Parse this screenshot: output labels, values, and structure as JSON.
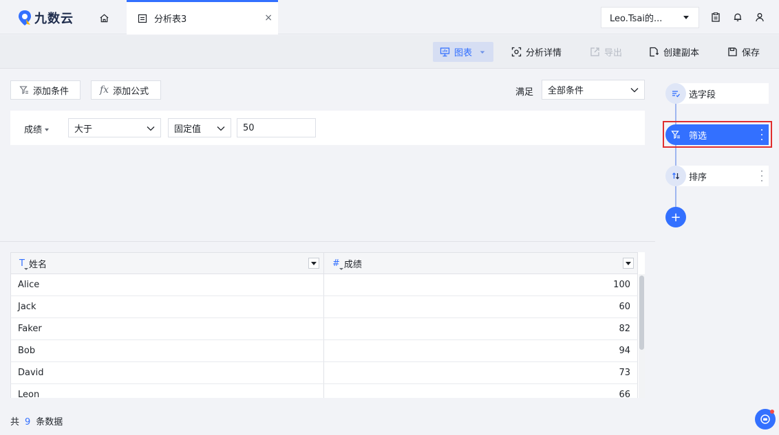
{
  "app": {
    "logo_text": "九数云"
  },
  "tab": {
    "label": "分析表3",
    "close_glyph": "×"
  },
  "user": {
    "name": "Leo.Tsai的..."
  },
  "toolbar": {
    "chart": "图表",
    "analysis_detail": "分析详情",
    "export": "导出",
    "create_copy": "创建副本",
    "save": "保存"
  },
  "filter": {
    "add_condition": "添加条件",
    "add_formula": "添加公式",
    "satisfy_label": "满足",
    "satisfy_value": "全部条件",
    "condition": {
      "field": "成绩",
      "operator": "大于",
      "value_type": "固定值",
      "value": "50"
    }
  },
  "table": {
    "columns": [
      {
        "type_icon": "T",
        "label": "姓名"
      },
      {
        "type_icon": "#",
        "label": "成绩"
      }
    ],
    "rows": [
      {
        "name": "Alice",
        "score": "100"
      },
      {
        "name": "Jack",
        "score": "60"
      },
      {
        "name": "Faker",
        "score": "82"
      },
      {
        "name": "Bob",
        "score": "94"
      },
      {
        "name": "David",
        "score": "73"
      },
      {
        "name": "Leon",
        "score": "66"
      }
    ]
  },
  "footer": {
    "prefix": "共",
    "count": "9",
    "suffix": "条数据"
  },
  "steps": [
    {
      "label": "选字段",
      "icon": "select-fields-icon",
      "active": false
    },
    {
      "label": "筛选",
      "icon": "filter-icon",
      "active": true
    },
    {
      "label": "排序",
      "icon": "sort-icon",
      "active": false
    }
  ],
  "colors": {
    "accent": "#3370ff",
    "highlight": "#e02e2e"
  }
}
